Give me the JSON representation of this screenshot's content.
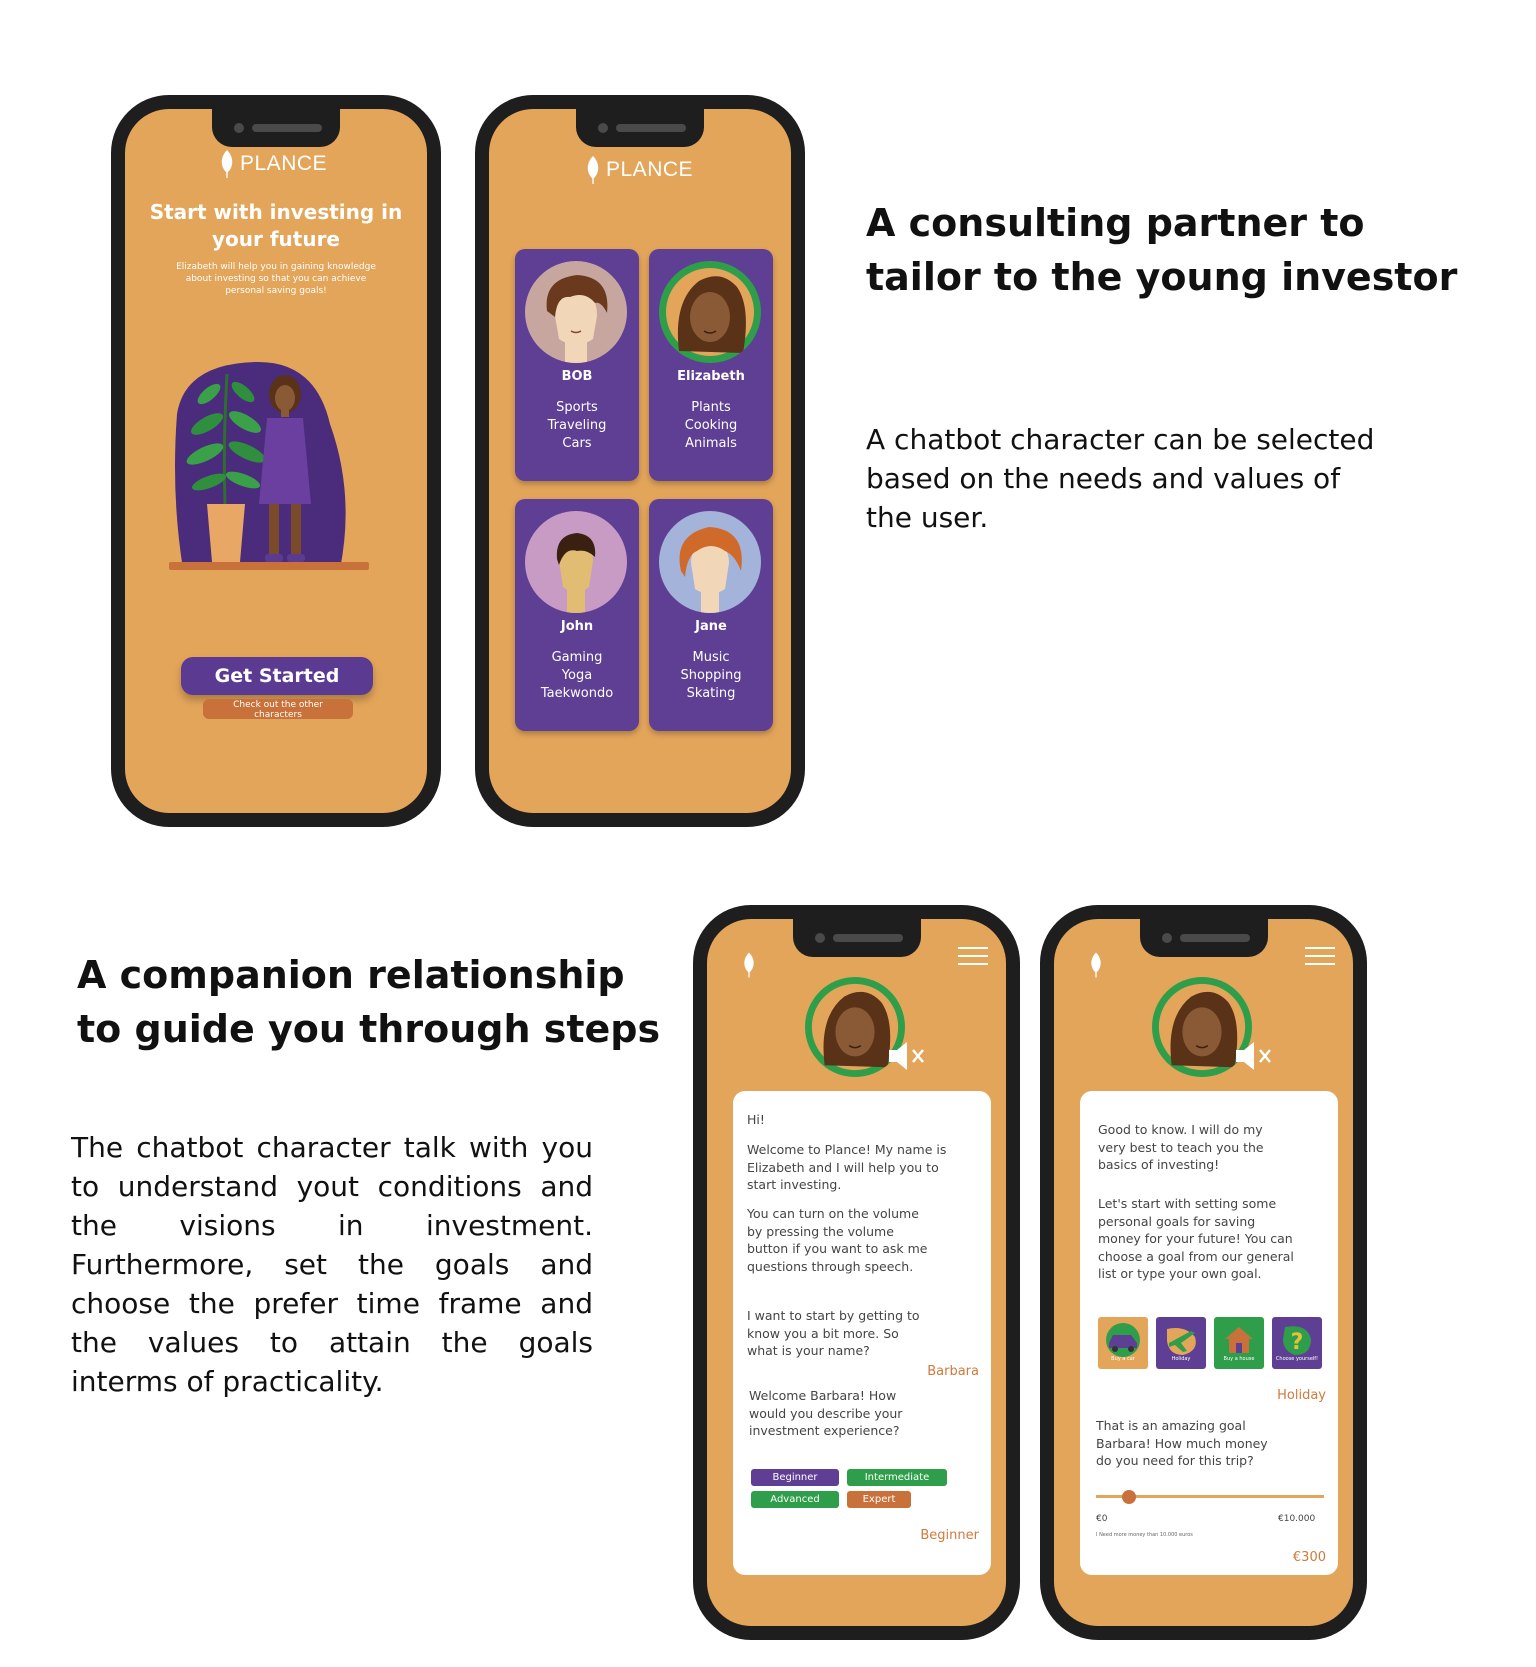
{
  "brand": {
    "name": "PLANCE"
  },
  "phone1": {
    "title": "Start with investing in your future",
    "subtitle": "Elizabeth will help you in gaining knowledge about investing so that you can achieve personal saving goals!",
    "cta_label": "Get Started",
    "secondary_label": "Check out the other characters"
  },
  "phone2": {
    "characters": [
      {
        "name": "BOB",
        "tags": [
          "Sports",
          "Traveling",
          "Cars"
        ]
      },
      {
        "name": "Elizabeth",
        "tags": [
          "Plants",
          "Cooking",
          "Animals"
        ]
      },
      {
        "name": "John",
        "tags": [
          "Gaming",
          "Yoga",
          "Taekwondo"
        ]
      },
      {
        "name": "Jane",
        "tags": [
          "Music",
          "Shopping",
          "Skating"
        ]
      }
    ]
  },
  "section1": {
    "heading": "A consulting partner to tailor to the young investor",
    "body": "A chatbot character can be selected based on the needs and values of the user."
  },
  "section2": {
    "heading": "A companion relationship to guide you through steps",
    "body": "The chatbot character talk with you to understand yout conditions and the visions in investment. Furthermore, set the goals and choose the prefer time frame and the values to attain the goals interms of practicality."
  },
  "phone3": {
    "messages": [
      "Hi!",
      "Welcome to Plance! My name is Elizabeth and I will help you to start investing.",
      "You can turn on the volume by pressing the volume button if you want to ask me questions through speech.",
      "I want to start by getting to know you a bit more. So what is your name?",
      "Welcome Barbara! How would you describe your investment experience?"
    ],
    "user_name_reply": "Barbara",
    "options": [
      "Beginner",
      "Intermediate",
      "Advanced",
      "Expert"
    ],
    "user_level_reply": "Beginner"
  },
  "phone4": {
    "messages": [
      "Good to know. I will do my very best to teach you the basics of investing!",
      "Let's start with setting some personal goals for saving money for your future! You can choose a goal from our general list or type your own goal.",
      "That is an amazing goal Barbara! How much money do you need for this trip?"
    ],
    "goals": [
      {
        "label": "Buy a car",
        "icon": "car-icon"
      },
      {
        "label": "Holiday",
        "icon": "plane-icon"
      },
      {
        "label": "Buy a house",
        "icon": "house-icon"
      },
      {
        "label": "Choose yourself!",
        "icon": "question-icon"
      }
    ],
    "goal_reply": "Holiday",
    "slider": {
      "min_label": "€0",
      "max_label": "€10.000",
      "value": 300,
      "min": 0,
      "max": 10000
    },
    "slider_note": "I Need more money than 10.000 euros",
    "amount_reply": "€300"
  },
  "colors": {
    "orange": "#e3a55a",
    "purple": "#5f3f93",
    "green": "#2f9e4a",
    "accent": "#d07a3b"
  }
}
